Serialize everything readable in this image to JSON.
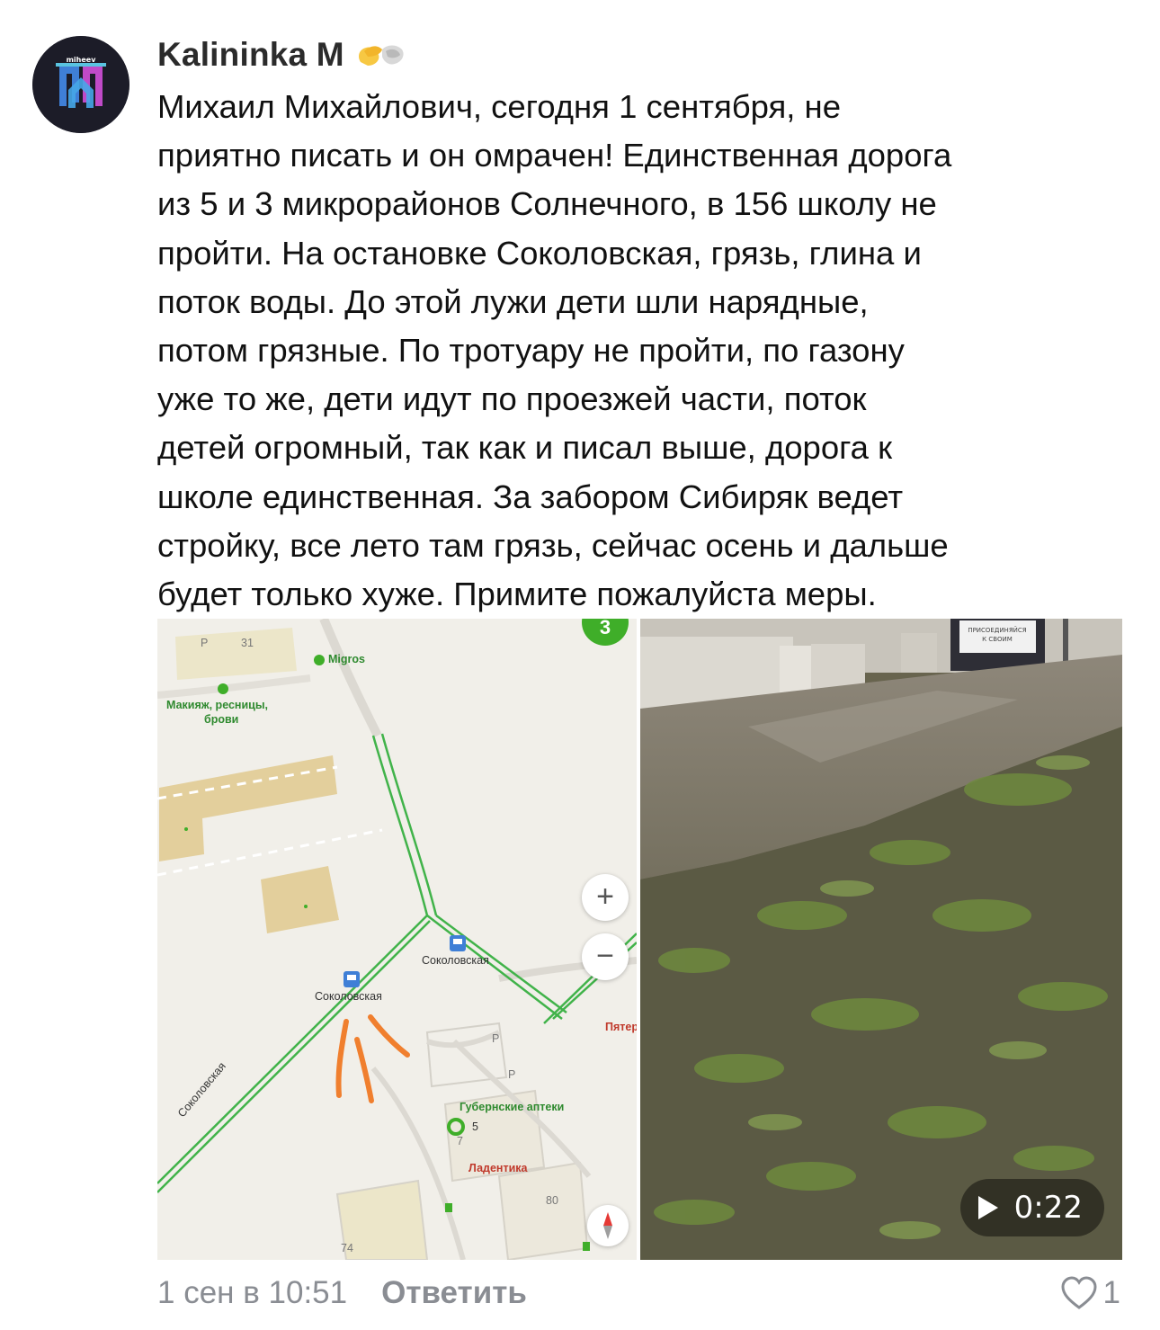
{
  "comment": {
    "author": "Kalininka M",
    "author_emoji_icon": "heart-hands-emoji-icon",
    "avatar_text": "miheev",
    "text": "Михаил Михайлович, сегодня 1 сентября, не\nприятно писать и он омрачен! Единственная дорога\nиз 5 и 3 микрорайонов Солнечного, в 156 школу не\nпройти. На остановке Соколовская, грязь, глина и\nпоток воды. До этой лужи дети шли нарядные,\nпотом грязные. По тротуару не пройти, по газону\nуже то же, дети идут по проезжей части, поток\nдетей огромный, так как и писал выше, дорога к\nшколе единственная. За забором Сибиряк ведет\nстройку, все лето там грязь, сейчас осень и  дальше\nбудет только хуже. Примите пожалуйста меры.",
    "timestamp": "1 сен в 10:51",
    "reply_label": "Ответить",
    "likes": "1"
  },
  "map": {
    "badge": "3",
    "labels": {
      "house_31": "31",
      "migros": "Migros",
      "makeup": "Макияж, ресницы,",
      "makeup2": "брови",
      "stop_right": "Соколовская",
      "stop_left": "Соколовская",
      "pyater": "Пятер",
      "street": "Соколовская",
      "pharmacy": "Губернские аптеки",
      "metro_5": "5",
      "house_7": "7",
      "ladentika": "Ладентика",
      "house_80": "80",
      "house_74": "74",
      "parking": "P"
    },
    "zoom_in": "+",
    "zoom_out": "−"
  },
  "video": {
    "duration": "0:22",
    "sign_line1": "ПРИСОЕДИНЯЙСЯ",
    "sign_line2": "К СВОИМ"
  },
  "colors": {
    "road_green": "#41b34a",
    "marker_orange": "#f07f2e",
    "meta_gray": "#8a8d93"
  }
}
